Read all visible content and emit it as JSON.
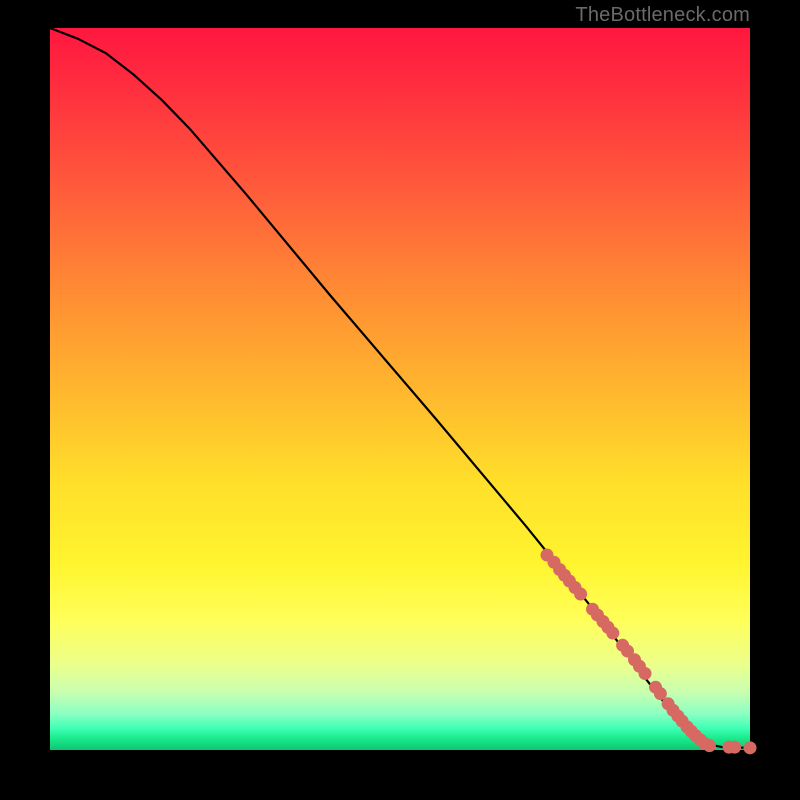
{
  "attribution": "TheBottleneck.com",
  "chart_data": {
    "type": "line",
    "title": "",
    "xlabel": "",
    "ylabel": "",
    "xlim": [
      0,
      100
    ],
    "ylim": [
      0,
      100
    ],
    "grid": false,
    "legend": false,
    "curve_points": [
      {
        "x": 0,
        "y": 100
      },
      {
        "x": 4,
        "y": 98.5
      },
      {
        "x": 8,
        "y": 96.5
      },
      {
        "x": 12,
        "y": 93.5
      },
      {
        "x": 16,
        "y": 90
      },
      {
        "x": 20,
        "y": 86
      },
      {
        "x": 28,
        "y": 77
      },
      {
        "x": 40,
        "y": 63
      },
      {
        "x": 55,
        "y": 46
      },
      {
        "x": 68,
        "y": 31
      },
      {
        "x": 78,
        "y": 19
      },
      {
        "x": 85,
        "y": 10
      },
      {
        "x": 89,
        "y": 5
      },
      {
        "x": 92,
        "y": 2
      },
      {
        "x": 94,
        "y": 0.8
      },
      {
        "x": 96,
        "y": 0.4
      },
      {
        "x": 100,
        "y": 0.3
      }
    ],
    "markers": [
      {
        "x": 71,
        "y": 27
      },
      {
        "x": 72,
        "y": 26
      },
      {
        "x": 72.8,
        "y": 25
      },
      {
        "x": 73.5,
        "y": 24.2
      },
      {
        "x": 74.2,
        "y": 23.4
      },
      {
        "x": 75,
        "y": 22.5
      },
      {
        "x": 75.8,
        "y": 21.6
      },
      {
        "x": 77.5,
        "y": 19.5
      },
      {
        "x": 78.2,
        "y": 18.7
      },
      {
        "x": 79,
        "y": 17.8
      },
      {
        "x": 79.7,
        "y": 17
      },
      {
        "x": 80.4,
        "y": 16.2
      },
      {
        "x": 81.8,
        "y": 14.5
      },
      {
        "x": 82.5,
        "y": 13.7
      },
      {
        "x": 83.5,
        "y": 12.5
      },
      {
        "x": 84.2,
        "y": 11.6
      },
      {
        "x": 85,
        "y": 10.6
      },
      {
        "x": 86.5,
        "y": 8.7
      },
      {
        "x": 87.2,
        "y": 7.8
      },
      {
        "x": 88.3,
        "y": 6.4
      },
      {
        "x": 89,
        "y": 5.5
      },
      {
        "x": 89.7,
        "y": 4.7
      },
      {
        "x": 90.3,
        "y": 4
      },
      {
        "x": 91,
        "y": 3.2
      },
      {
        "x": 91.6,
        "y": 2.6
      },
      {
        "x": 92.2,
        "y": 2
      },
      {
        "x": 92.9,
        "y": 1.4
      },
      {
        "x": 93.5,
        "y": 0.9
      },
      {
        "x": 94.2,
        "y": 0.6
      },
      {
        "x": 97,
        "y": 0.4
      },
      {
        "x": 97.8,
        "y": 0.4
      },
      {
        "x": 100,
        "y": 0.3
      }
    ]
  }
}
